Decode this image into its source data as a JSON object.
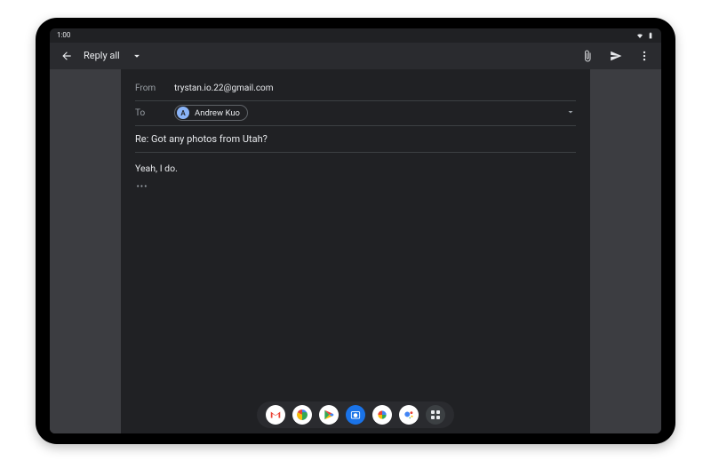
{
  "status": {
    "time": "1:00"
  },
  "appbar": {
    "title": "Reply all"
  },
  "compose": {
    "from_label": "From",
    "from_address": "trystan.io.22@gmail.com",
    "to_label": "To",
    "to_chip": {
      "initial": "A",
      "name": "Andrew Kuo"
    },
    "subject": "Re: Got any photos from Utah?",
    "body": "Yeah, I do."
  },
  "taskbar": {
    "apps": [
      "gmail",
      "chrome",
      "play",
      "camera",
      "photos",
      "assistant"
    ]
  }
}
